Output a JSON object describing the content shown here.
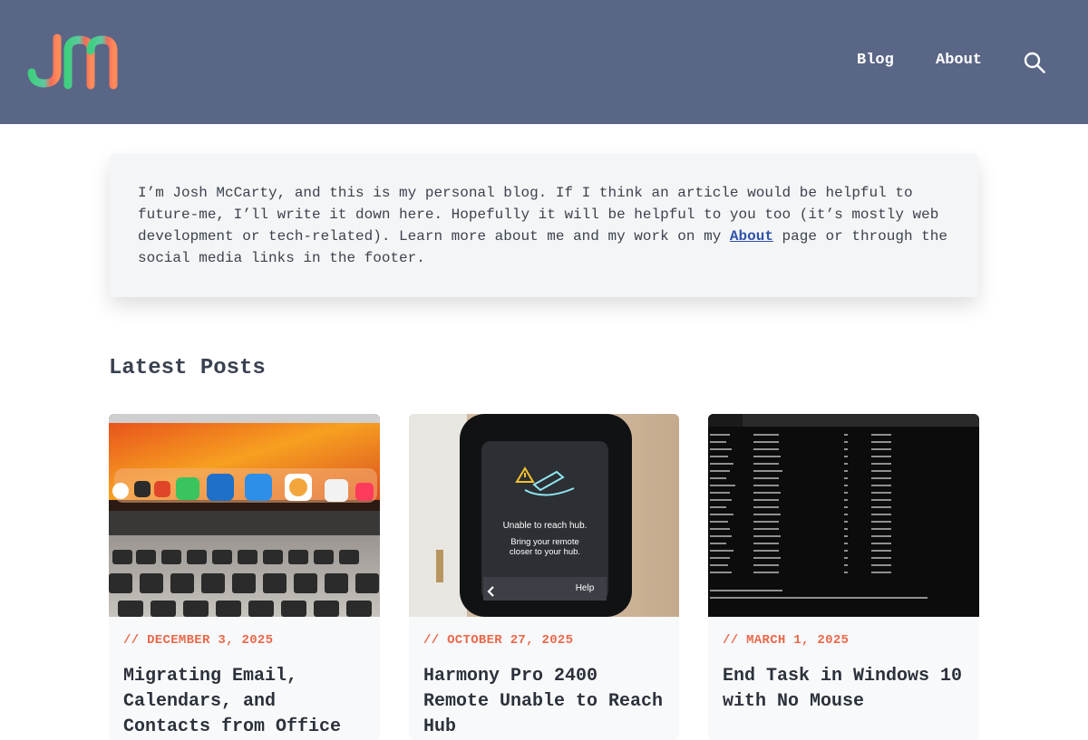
{
  "header": {
    "nav": [
      {
        "label": "Blog"
      },
      {
        "label": "About"
      }
    ]
  },
  "intro": {
    "text_before": "I’m Josh McCarty, and this is my personal blog. If I think an article would be helpful to future-me, I’ll write it down here. Hopefully it will be helpful to you too (it’s mostly web development or tech-related). Learn more about me and my work on my ",
    "link_label": "About",
    "text_after": " page or through the social media links in the footer."
  },
  "posts_section": {
    "title": "Latest Posts",
    "posts": [
      {
        "date": "// DECEMBER 3, 2025",
        "title": "Migrating Email, Calendars, and Contacts from Office"
      },
      {
        "date": "// OCTOBER 27, 2025",
        "title": "Harmony Pro 2400 Remote Unable to Reach Hub",
        "image_text": {
          "line1": "Unable to reach hub.",
          "line2": "Bring your remote",
          "line3": "closer to your hub.",
          "button": "Help"
        }
      },
      {
        "date": "// MARCH 1, 2025",
        "title": "End Task in Windows 10 with No Mouse"
      }
    ]
  },
  "colors": {
    "header_bg": "#5a6686",
    "accent": "#e8694b",
    "link": "#2f52a8"
  },
  "icons": {
    "logo": "jm-logo",
    "search": "search-icon"
  }
}
